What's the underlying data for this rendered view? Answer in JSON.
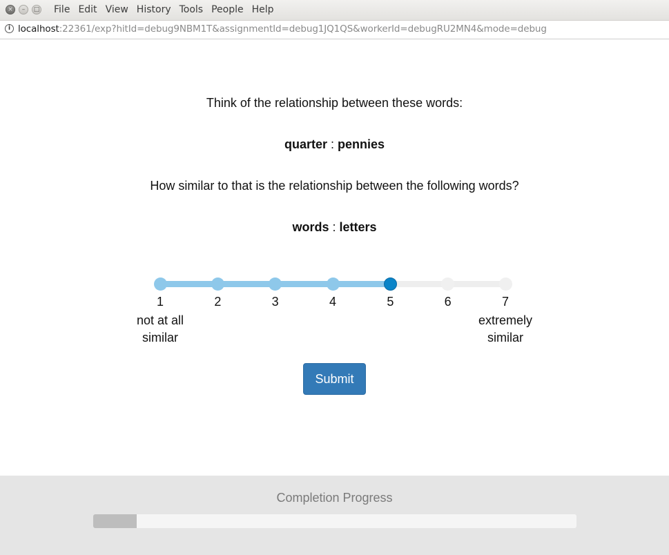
{
  "window": {
    "buttons": [
      "×",
      "–",
      "□"
    ],
    "menu": [
      "File",
      "Edit",
      "View",
      "History",
      "Tools",
      "People",
      "Help"
    ]
  },
  "urlbar": {
    "host": "localhost",
    "rest": ":22361/exp?hitId=debug9NBM1T&assignmentId=debug1JQ1QS&workerId=debugRU2MN4&mode=debug"
  },
  "prompt": {
    "intro": "Think of the relationship between these words:",
    "pair1": {
      "left": "quarter",
      "sep": " : ",
      "right": "pennies"
    },
    "question": "How similar to that is the relationship between the following words?",
    "pair2": {
      "left": "words",
      "sep": " : ",
      "right": "letters"
    }
  },
  "rating": {
    "scale": [
      "1",
      "2",
      "3",
      "4",
      "5",
      "6",
      "7"
    ],
    "selected": 5,
    "low_anchor": [
      "not at all",
      "similar"
    ],
    "high_anchor": [
      "extremely",
      "similar"
    ],
    "colors": {
      "filled": "#8ec8ea",
      "selected": "#0a84c8",
      "empty": "#f0f0f0"
    }
  },
  "submit_label": "Submit",
  "footer": {
    "title": "Completion Progress",
    "progress_fraction": 0.09
  }
}
